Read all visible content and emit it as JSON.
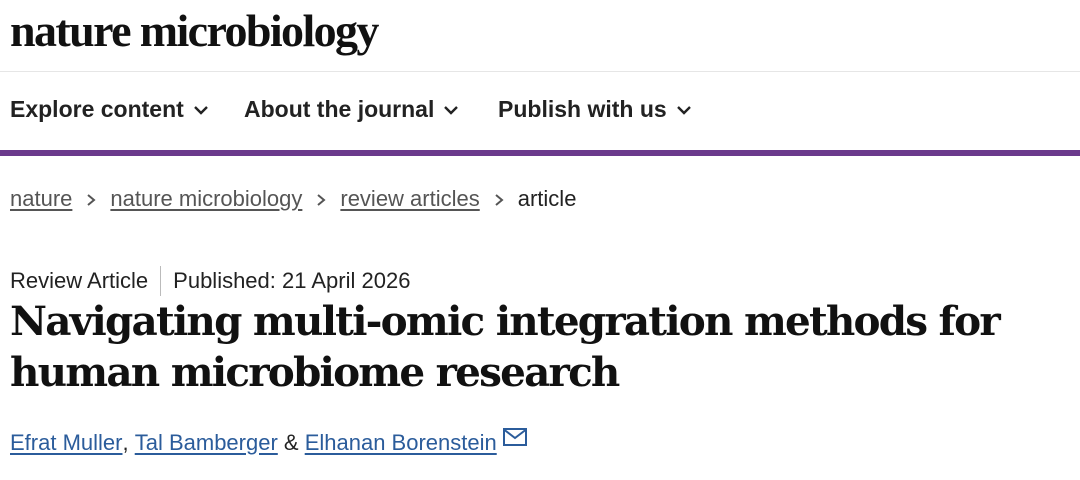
{
  "journal": {
    "logo_text": "nature microbiology"
  },
  "nav": {
    "items": [
      {
        "label": "Explore content",
        "icon": "chevron-down-icon"
      },
      {
        "label": "About the journal",
        "icon": "chevron-down-icon"
      },
      {
        "label": "Publish with us",
        "icon": "chevron-down-icon"
      }
    ]
  },
  "breadcrumb": {
    "items": [
      "nature",
      "nature microbiology",
      "review articles"
    ],
    "current": "article",
    "separator_icon": "chevron-right-icon"
  },
  "article": {
    "type": "Review Article",
    "published": "Published: 21 April 2026",
    "title": "Navigating multi-omic integration methods for human microbiome research",
    "authors": [
      "Efrat Muller",
      "Tal Bamberger",
      "Elhanan Borenstein"
    ],
    "author_sep_1": ", ",
    "author_sep_2": " & ",
    "contact_icon": "mail-icon"
  },
  "colors": {
    "accent_rule": "#6b3a8c",
    "author_link": "#2b5c9b"
  }
}
